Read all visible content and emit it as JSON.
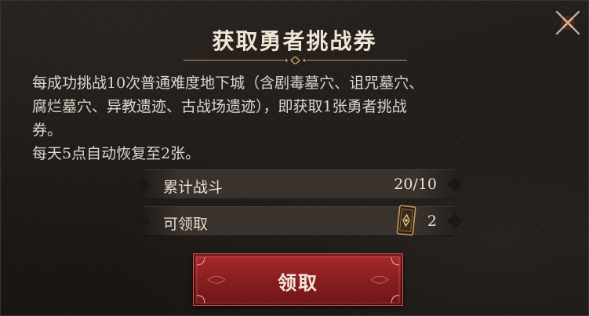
{
  "dialog": {
    "title": "获取勇者挑战券",
    "description_line1": "每成功挑战10次普通难度地下城（含剧毒墓穴、诅咒墓穴、",
    "description_line2": "腐烂墓穴、异教遗迹、古战场遗迹），即获取1张勇者挑战",
    "description_line3": "券。",
    "description_line4": "每天5点自动恢复至2张。",
    "stats": [
      {
        "label": "累计战斗",
        "value": "20/10"
      },
      {
        "label": "可领取",
        "value": "2",
        "icon": "challenge-ticket-icon"
      }
    ],
    "claim_button_label": "领取",
    "close_icon": "close-x-icon"
  },
  "colors": {
    "panel_background": "#1c1816",
    "title_text": "#efe6d6",
    "button_red": "#8b1f22",
    "gold_accent": "#c7a16a"
  }
}
